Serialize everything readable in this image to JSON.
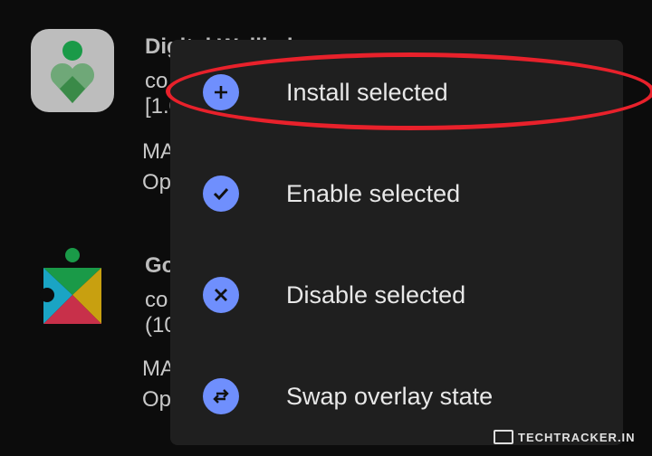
{
  "apps": [
    {
      "name": "Digital Wellbei",
      "line1": "co",
      "line2": "[1.0",
      "line3": "MA",
      "line4": "Op"
    },
    {
      "name": "Go",
      "line1": "co",
      "line2": "(10",
      "line3": "MA",
      "line4": "Op"
    }
  ],
  "menu": {
    "items": [
      {
        "label": "Install selected",
        "icon": "plus-icon"
      },
      {
        "label": "Enable selected",
        "icon": "check-icon"
      },
      {
        "label": "Disable selected",
        "icon": "x-icon"
      },
      {
        "label": "Swap overlay state",
        "icon": "swap-arrows-icon"
      }
    ]
  },
  "watermark": "TECHTRACKER.IN",
  "colors": {
    "accent": "#6f8ffd",
    "highlight": "#e8212b",
    "menu_bg": "#1f1f1f"
  }
}
